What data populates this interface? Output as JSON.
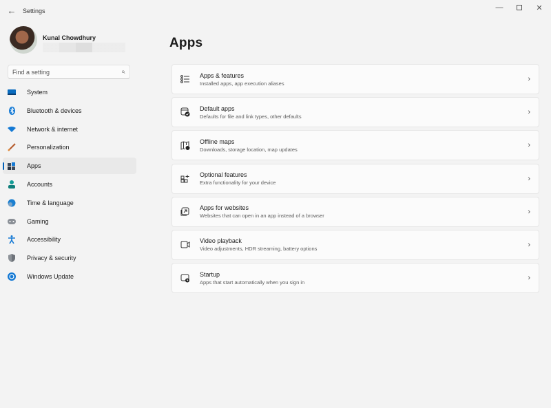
{
  "window": {
    "title": "Settings",
    "controls": {
      "minimize": "—",
      "close": "✕"
    },
    "back_glyph": "←"
  },
  "profile": {
    "name": "Kunal Chowdhury"
  },
  "search": {
    "placeholder": "Find a setting",
    "icon_glyph": "⌕"
  },
  "sidebar": {
    "items": [
      {
        "label": "System",
        "icon": "system-icon",
        "active": false
      },
      {
        "label": "Bluetooth & devices",
        "icon": "bluetooth-icon",
        "active": false
      },
      {
        "label": "Network & internet",
        "icon": "wifi-icon",
        "active": false
      },
      {
        "label": "Personalization",
        "icon": "brush-icon",
        "active": false
      },
      {
        "label": "Apps",
        "icon": "apps-icon",
        "active": true
      },
      {
        "label": "Accounts",
        "icon": "person-icon",
        "active": false
      },
      {
        "label": "Time & language",
        "icon": "globe-clock-icon",
        "active": false
      },
      {
        "label": "Gaming",
        "icon": "gamepad-icon",
        "active": false
      },
      {
        "label": "Accessibility",
        "icon": "accessibility-icon",
        "active": false
      },
      {
        "label": "Privacy & security",
        "icon": "shield-icon",
        "active": false
      },
      {
        "label": "Windows Update",
        "icon": "update-icon",
        "active": false
      }
    ]
  },
  "main": {
    "title": "Apps",
    "chevron": "›",
    "cards": [
      {
        "title": "Apps & features",
        "desc": "Installed apps, app execution aliases",
        "icon": "list-icon"
      },
      {
        "title": "Default apps",
        "desc": "Defaults for file and link types, other defaults",
        "icon": "default-apps-icon"
      },
      {
        "title": "Offline maps",
        "desc": "Downloads, storage location, map updates",
        "icon": "map-icon"
      },
      {
        "title": "Optional features",
        "desc": "Extra functionality for your device",
        "icon": "grid-plus-icon"
      },
      {
        "title": "Apps for websites",
        "desc": "Websites that can open in an app instead of a browser",
        "icon": "open-external-icon"
      },
      {
        "title": "Video playback",
        "desc": "Video adjustments, HDR streaming, battery options",
        "icon": "video-icon"
      },
      {
        "title": "Startup",
        "desc": "Apps that start automatically when you sign in",
        "icon": "startup-icon"
      }
    ]
  },
  "colors": {
    "accent": "#005fb8",
    "background": "#f3f3f3",
    "card": "#fbfbfb"
  }
}
